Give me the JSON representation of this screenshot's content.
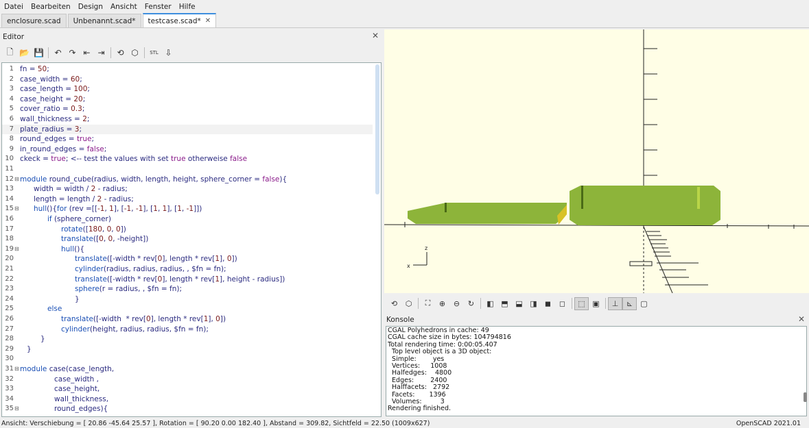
{
  "menu": [
    "Datei",
    "Bearbeiten",
    "Design",
    "Ansicht",
    "Fenster",
    "Hilfe"
  ],
  "tabs": [
    {
      "label": "enclosure.scad",
      "active": false
    },
    {
      "label": "Unbenannt.scad*",
      "active": false
    },
    {
      "label": "testcase.scad*",
      "active": true
    }
  ],
  "editor": {
    "title": "Editor",
    "toolbar_icons": [
      "new-file-icon",
      "open-file-icon",
      "save-icon",
      "undo-icon",
      "redo-icon",
      "unindent-icon",
      "indent-icon",
      "preview-icon",
      "render-icon",
      "export-stl-icon",
      "send-to-printer-icon"
    ],
    "lines": [
      {
        "n": "1",
        "indent": 0,
        "parts": [
          [
            "t",
            "fn = "
          ],
          [
            "n",
            "50"
          ],
          [
            "t",
            ";"
          ]
        ]
      },
      {
        "n": "2",
        "indent": 0,
        "parts": [
          [
            "t",
            "case_width = "
          ],
          [
            "n",
            "60"
          ],
          [
            "t",
            ";"
          ]
        ]
      },
      {
        "n": "3",
        "indent": 0,
        "parts": [
          [
            "t",
            "case_length = "
          ],
          [
            "n",
            "100"
          ],
          [
            "t",
            ";"
          ]
        ]
      },
      {
        "n": "4",
        "indent": 0,
        "parts": [
          [
            "t",
            "case_height = "
          ],
          [
            "n",
            "20"
          ],
          [
            "t",
            ";"
          ]
        ]
      },
      {
        "n": "5",
        "indent": 0,
        "parts": [
          [
            "t",
            "cover_ratio = "
          ],
          [
            "n",
            "0.3"
          ],
          [
            "t",
            ";"
          ]
        ]
      },
      {
        "n": "6",
        "indent": 0,
        "parts": [
          [
            "t",
            "wall_thickness = "
          ],
          [
            "n",
            "2"
          ],
          [
            "t",
            ";"
          ]
        ]
      },
      {
        "n": "7",
        "indent": 0,
        "hl": true,
        "parts": [
          [
            "t",
            "plate_radius = "
          ],
          [
            "n",
            "3"
          ],
          [
            "t",
            ";"
          ]
        ]
      },
      {
        "n": "8",
        "indent": 0,
        "parts": [
          [
            "t",
            "round_edges = "
          ],
          [
            "b",
            "true"
          ],
          [
            "t",
            ";"
          ]
        ]
      },
      {
        "n": "9",
        "indent": 0,
        "parts": [
          [
            "t",
            "in_round_edges = "
          ],
          [
            "b",
            "false"
          ],
          [
            "t",
            ";"
          ]
        ]
      },
      {
        "n": "10",
        "indent": 0,
        "parts": [
          [
            "t",
            "ckeck = "
          ],
          [
            "b",
            "true"
          ],
          [
            "t",
            "; <-- test the values with set "
          ],
          [
            "b",
            "true"
          ],
          [
            "t",
            " otherweise "
          ],
          [
            "b",
            "false"
          ]
        ]
      },
      {
        "n": "11",
        "indent": 0,
        "parts": []
      },
      {
        "n": "12",
        "indent": 0,
        "fold": "minus",
        "parts": [
          [
            "k",
            "module"
          ],
          [
            "t",
            " round_cube(radius, width, length, height, sphere_corner = "
          ],
          [
            "b",
            "false"
          ],
          [
            "t",
            "){"
          ]
        ]
      },
      {
        "n": "13",
        "indent": 1,
        "parts": [
          [
            "t",
            "width = width / "
          ],
          [
            "n",
            "2"
          ],
          [
            "t",
            " - radius;"
          ]
        ]
      },
      {
        "n": "14",
        "indent": 1,
        "parts": [
          [
            "t",
            "length = length / "
          ],
          [
            "n",
            "2"
          ],
          [
            "t",
            " - radius;"
          ]
        ]
      },
      {
        "n": "15",
        "indent": 1,
        "fold": "minus",
        "parts": [
          [
            "k",
            "hull"
          ],
          [
            "t",
            "(){"
          ],
          [
            "k",
            "for"
          ],
          [
            "t",
            " (rev =[["
          ],
          [
            "n",
            "-1"
          ],
          [
            "t",
            ", "
          ],
          [
            "n",
            "1"
          ],
          [
            "t",
            "], ["
          ],
          [
            "n",
            "-1"
          ],
          [
            "t",
            ", "
          ],
          [
            "n",
            "-1"
          ],
          [
            "t",
            "], ["
          ],
          [
            "n",
            "1"
          ],
          [
            "t",
            ", "
          ],
          [
            "n",
            "1"
          ],
          [
            "t",
            "], ["
          ],
          [
            "n",
            "1"
          ],
          [
            "t",
            ", "
          ],
          [
            "n",
            "-1"
          ],
          [
            "t",
            "]])"
          ]
        ]
      },
      {
        "n": "16",
        "indent": 2,
        "parts": [
          [
            "k",
            "if"
          ],
          [
            "t",
            " (sphere_corner)"
          ]
        ]
      },
      {
        "n": "17",
        "indent": 3,
        "parts": [
          [
            "k",
            "rotate"
          ],
          [
            "t",
            "(["
          ],
          [
            "n",
            "180"
          ],
          [
            "t",
            ", "
          ],
          [
            "n",
            "0"
          ],
          [
            "t",
            ", "
          ],
          [
            "n",
            "0"
          ],
          [
            "t",
            "])"
          ]
        ]
      },
      {
        "n": "18",
        "indent": 3,
        "parts": [
          [
            "k",
            "translate"
          ],
          [
            "t",
            "(["
          ],
          [
            "n",
            "0"
          ],
          [
            "t",
            ", "
          ],
          [
            "n",
            "0"
          ],
          [
            "t",
            ", -height])"
          ]
        ]
      },
      {
        "n": "19",
        "indent": 3,
        "fold": "minus",
        "parts": [
          [
            "k",
            "hull"
          ],
          [
            "t",
            "(){"
          ]
        ]
      },
      {
        "n": "20",
        "indent": 4,
        "parts": [
          [
            "k",
            "translate"
          ],
          [
            "t",
            "([-width * rev["
          ],
          [
            "n",
            "0"
          ],
          [
            "t",
            "], length * rev["
          ],
          [
            "n",
            "1"
          ],
          [
            "t",
            "], "
          ],
          [
            "n",
            "0"
          ],
          [
            "t",
            "])"
          ]
        ]
      },
      {
        "n": "21",
        "indent": 4,
        "parts": [
          [
            "k",
            "cylinder"
          ],
          [
            "t",
            "(radius, radius, radius, , $fn = fn);"
          ]
        ]
      },
      {
        "n": "22",
        "indent": 4,
        "parts": [
          [
            "k",
            "translate"
          ],
          [
            "t",
            "([-width * rev["
          ],
          [
            "n",
            "0"
          ],
          [
            "t",
            "], length * rev["
          ],
          [
            "n",
            "1"
          ],
          [
            "t",
            "], height - radius])"
          ]
        ]
      },
      {
        "n": "23",
        "indent": 4,
        "parts": [
          [
            "k",
            "sphere"
          ],
          [
            "t",
            "(r = radius, , $fn = fn);"
          ]
        ]
      },
      {
        "n": "24",
        "indent": 4,
        "parts": [
          [
            "t",
            "}"
          ]
        ]
      },
      {
        "n": "25",
        "indent": 2,
        "parts": [
          [
            "k",
            "else"
          ]
        ]
      },
      {
        "n": "26",
        "indent": 3,
        "parts": [
          [
            "k",
            "translate"
          ],
          [
            "t",
            "([-width  * rev["
          ],
          [
            "n",
            "0"
          ],
          [
            "t",
            "], length * rev["
          ],
          [
            "n",
            "1"
          ],
          [
            "t",
            "], "
          ],
          [
            "n",
            "0"
          ],
          [
            "t",
            "])"
          ]
        ]
      },
      {
        "n": "27",
        "indent": 3,
        "parts": [
          [
            "k",
            "cylinder"
          ],
          [
            "t",
            "(height, radius, radius, $fn = fn);"
          ]
        ]
      },
      {
        "n": "28",
        "indent": 1.5,
        "parts": [
          [
            "t",
            "}"
          ]
        ]
      },
      {
        "n": "29",
        "indent": 0.5,
        "parts": [
          [
            "t",
            "}"
          ]
        ]
      },
      {
        "n": "30",
        "indent": 0,
        "parts": []
      },
      {
        "n": "31",
        "indent": 0,
        "fold": "minus",
        "parts": [
          [
            "k",
            "module"
          ],
          [
            "t",
            " case(case_length,"
          ]
        ]
      },
      {
        "n": "32",
        "indent": 2.5,
        "parts": [
          [
            "t",
            "case_width ,"
          ]
        ]
      },
      {
        "n": "33",
        "indent": 2.5,
        "parts": [
          [
            "t",
            "case_height,"
          ]
        ]
      },
      {
        "n": "34",
        "indent": 2.5,
        "parts": [
          [
            "t",
            "wall_thickness,"
          ]
        ]
      },
      {
        "n": "35",
        "indent": 2.5,
        "fold": "minus",
        "parts": [
          [
            "t",
            "round_edges){"
          ]
        ]
      }
    ]
  },
  "viewport": {
    "background": "#fffee6",
    "model_color": "#8db43a",
    "axis_labels": {
      "z": "z",
      "x": "x"
    }
  },
  "view_toolbar_icons": [
    "preview-icon",
    "render-icon",
    "view-all-icon",
    "zoom-in-icon",
    "zoom-out-icon",
    "reset-view-icon",
    "view-right-icon",
    "view-top-icon",
    "view-bottom-icon",
    "view-left-icon",
    "view-front-icon",
    "view-back-icon",
    "perspective-icon",
    "orthogonal-icon",
    "show-axes-icon",
    "show-scale-icon",
    "show-edges-icon"
  ],
  "console": {
    "title": "Konsole",
    "lines": [
      "CGAL Polyhedrons in cache: 49",
      "CGAL cache size in bytes: 104794816",
      "Total rendering time: 0:00:05.407",
      "  Top level object is a 3D object:",
      "  Simple:        yes",
      "  Vertices:     1008",
      "  Halfedges:    4800",
      "  Edges:        2400",
      "  Halffacets:   2792",
      "  Facets:       1396",
      "  Volumes:         3",
      "Rendering finished."
    ]
  },
  "status": {
    "left": "Ansicht: Verschiebung = [ 20.86 -45.64 25.57 ], Rotation = [ 90.20 0.00 182.40 ], Abstand = 309.82, Sichtfeld = 22.50 (1009x627)",
    "right": "OpenSCAD 2021.01"
  }
}
